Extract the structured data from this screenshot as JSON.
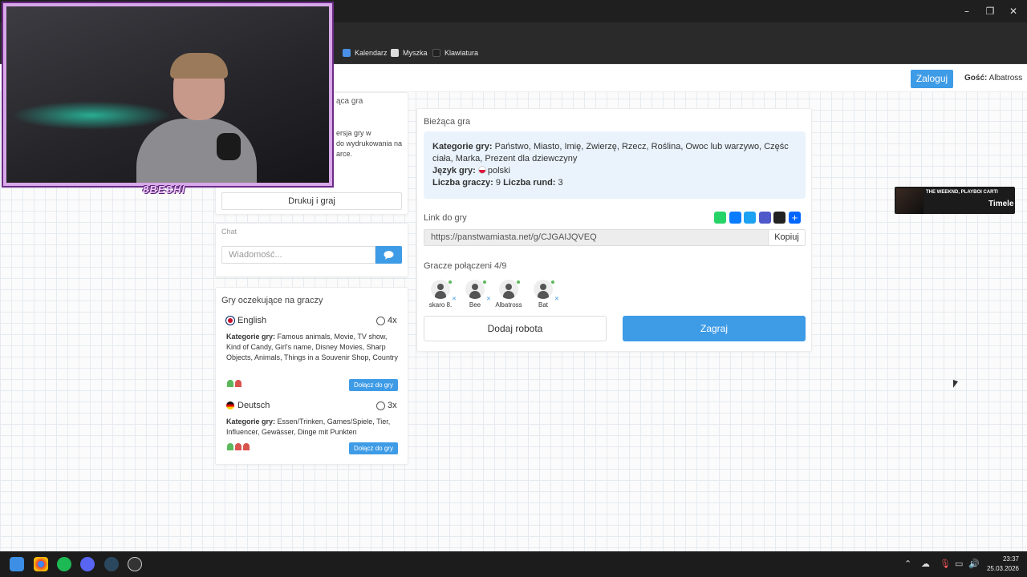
{
  "browser": {
    "bookmarks": [
      {
        "label": "Kalendarz",
        "icon": "calendar-icon",
        "color": "#4a8fe7"
      },
      {
        "label": "Myszka",
        "icon": "mouse-icon",
        "color": "#dddddd"
      },
      {
        "label": "Klawiatura",
        "icon": "keyboard-icon",
        "color": "#222222"
      }
    ]
  },
  "header": {
    "login_label": "Zaloguj",
    "guest_prefix": "Gość:",
    "guest_name": "Albatross"
  },
  "left": {
    "partial_title": "ąca gra",
    "partial_text": [
      "ersja gry w",
      "do wydrukowania na",
      "arce."
    ],
    "print_button": "Drukuj i graj",
    "chat": {
      "label": "Chat",
      "placeholder": "Wiadomość..."
    },
    "waiting": {
      "title": "Gry oczekujące na graczy",
      "games": [
        {
          "language": "English",
          "rounds": "4x",
          "categories_label": "Kategorie gry:",
          "categories": "Famous animals, Movie, TV show, Kind of Candy, Girl's name, Disney Movies, Sharp Objects, Animals, Things in a Souvenir Shop, Country",
          "players_green": 1,
          "players_red": 1,
          "join_label": "Dołącz do gry"
        },
        {
          "language": "Deutsch",
          "rounds": "3x",
          "categories_label": "Kategorie gry:",
          "categories": "Essen/Trinken, Games/Spiele, Tier, Influencer, Gewässer, Dinge mit Punkten",
          "players_green": 1,
          "players_red": 2,
          "join_label": "Dołącz do gry"
        }
      ]
    }
  },
  "main": {
    "title": "Bieżąca gra",
    "info": {
      "categories_label": "Kategorie gry:",
      "categories_line1": "Państwo, Miasto, Imię, Zwierzę, Rzecz, Roślina, Owoc lub warzywo, Częśc",
      "categories_line2": "ciała, Marka, Prezent dla dziewczyny",
      "language_label": "Język gry:",
      "language": "polski",
      "players_label": "Liczba graczy:",
      "players_count": "9",
      "rounds_label": "Liczba rund:",
      "rounds_count": "3"
    },
    "link_label": "Link do gry",
    "link_url": "https://panstwamiasta.net/g/CJGAIJQVEQ",
    "copy_label": "Kopiuj",
    "players_connected": "Gracze połączeni 4/9",
    "players": [
      "skaro 8.",
      "Bee",
      "Albatross",
      "Bat"
    ],
    "add_robot": "Dodaj robota",
    "play": "Zagraj",
    "share_icons": [
      {
        "name": "whatsapp-icon",
        "color": "#25d366"
      },
      {
        "name": "messenger-icon",
        "color": "#0a7cff"
      },
      {
        "name": "twitter-icon",
        "color": "#1da1f2"
      },
      {
        "name": "teams-icon",
        "color": "#5059c9"
      },
      {
        "name": "snapchat-icon",
        "color": "#222222"
      },
      {
        "name": "share-plus-icon",
        "color": "#0166ff"
      }
    ]
  },
  "overlay": {
    "streamer_tag": "8BESHI",
    "music_artist": "THE WEEKND, PLAYBOI CARTI",
    "music_track": "Timele"
  },
  "taskbar": {
    "time": "23:37",
    "date": "25.03.2026"
  },
  "colors": {
    "accent": "#3e9be6",
    "info_bg": "#eaf3fc",
    "webcam_frame": "#d8a8e8"
  }
}
